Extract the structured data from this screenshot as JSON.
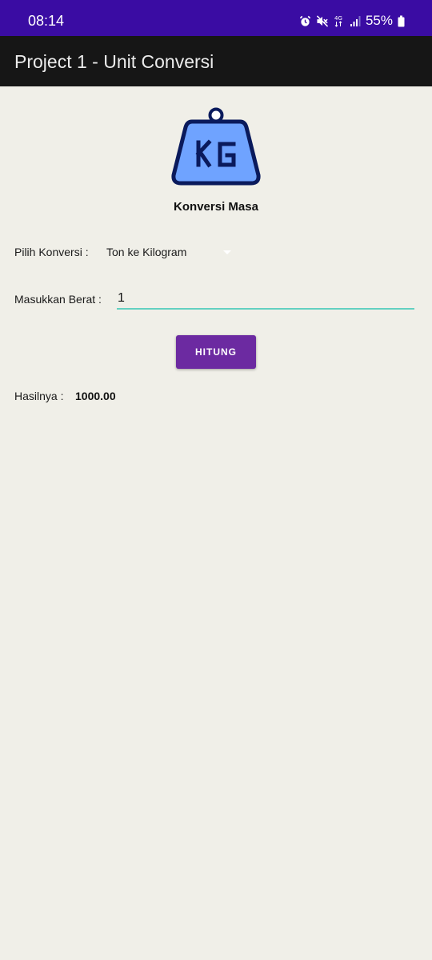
{
  "status_bar": {
    "time": "08:14",
    "battery": "55%",
    "icons": [
      "alarm-icon",
      "mute-icon",
      "4g-icon",
      "signal-icon",
      "battery-icon"
    ],
    "network": "4G"
  },
  "app_bar": {
    "title": "Project 1 - Unit Conversi"
  },
  "logo": {
    "icon": "kg-weight-icon",
    "text": "KG"
  },
  "main": {
    "section_title": "Konversi Masa",
    "conversion_label": "Pilih Konversi :",
    "conversion_selected": "Ton ke Kilogram",
    "weight_label": "Masukkan Berat :",
    "weight_value": "1",
    "calculate_label": "HITUNG",
    "result_label": "Hasilnya :",
    "result_value": "1000.00"
  },
  "colors": {
    "status_bar": "#3a0ca3",
    "app_bar": "#161616",
    "background": "#f0efe8",
    "button": "#6c2aa1",
    "input_underline": "#63d1c1",
    "logo_fill": "#6fa3ff",
    "logo_outline": "#0a1a5c"
  }
}
